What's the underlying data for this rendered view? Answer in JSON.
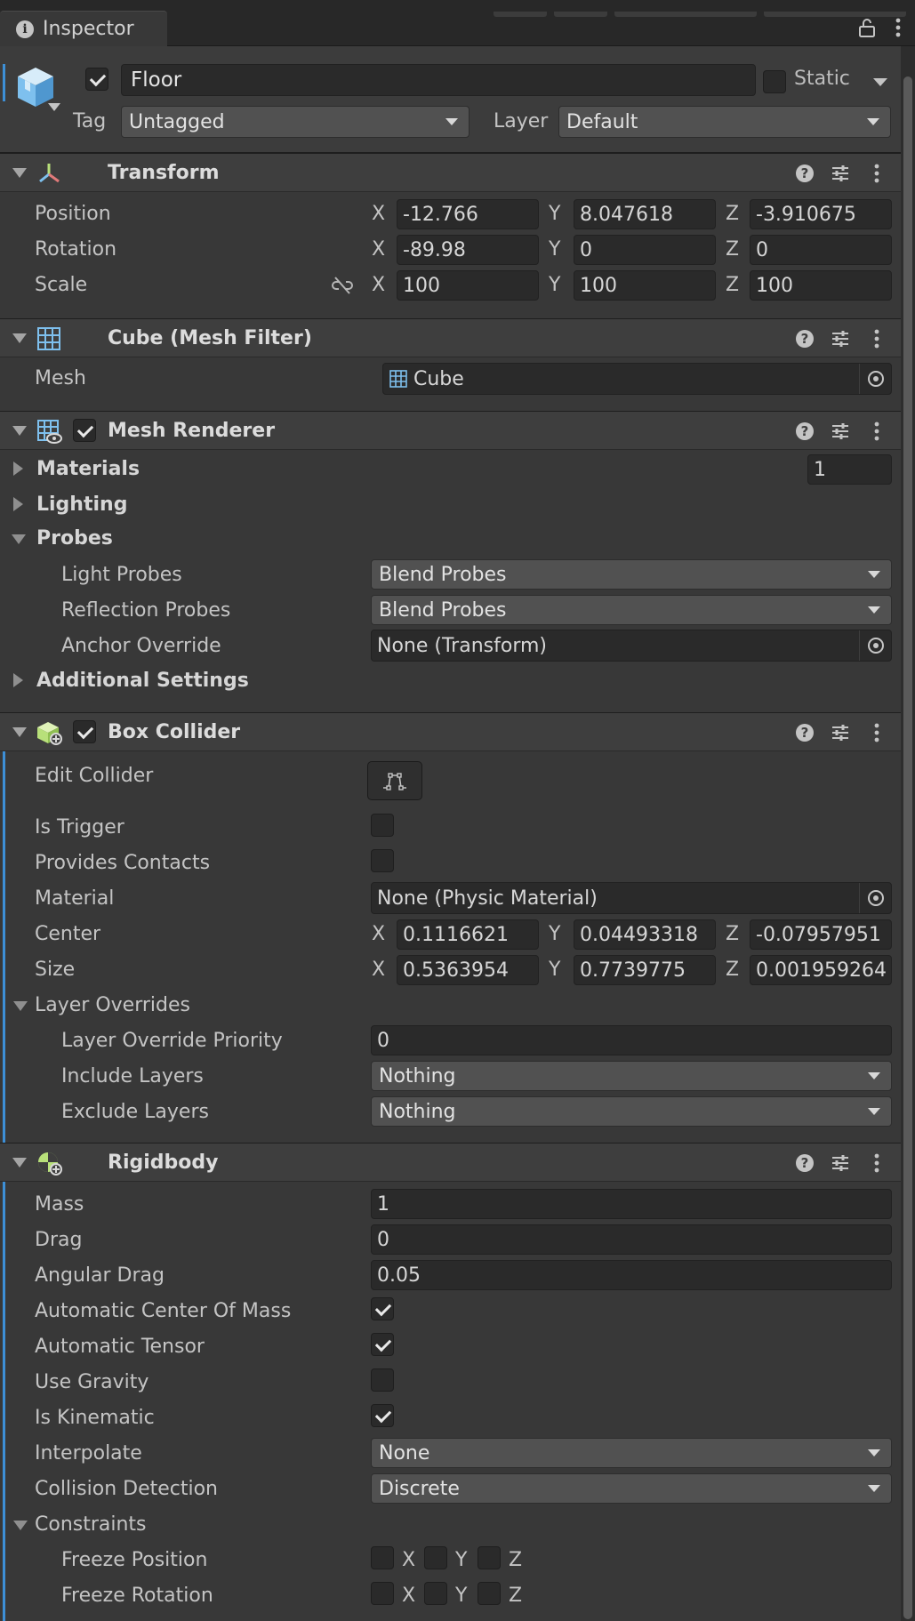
{
  "tab": {
    "title": "Inspector"
  },
  "gameobject": {
    "name": "Floor",
    "active": true,
    "static_label": "Static",
    "static": false,
    "tag_label": "Tag",
    "tag": "Untagged",
    "layer_label": "Layer",
    "layer": "Default"
  },
  "transform": {
    "title": "Transform",
    "position_label": "Position",
    "rotation_label": "Rotation",
    "scale_label": "Scale",
    "axis": {
      "x": "X",
      "y": "Y",
      "z": "Z"
    },
    "position": {
      "x": "-12.766",
      "y": "8.047618",
      "z": "-3.910675"
    },
    "rotation": {
      "x": "-89.98",
      "y": "0",
      "z": "0"
    },
    "scale": {
      "x": "100",
      "y": "100",
      "z": "100"
    }
  },
  "mesh_filter": {
    "title": "Cube (Mesh Filter)",
    "mesh_label": "Mesh",
    "mesh": "Cube"
  },
  "mesh_renderer": {
    "title": "Mesh Renderer",
    "enabled": true,
    "materials_label": "Materials",
    "materials_count": "1",
    "lighting_label": "Lighting",
    "probes_label": "Probes",
    "light_probes_label": "Light Probes",
    "light_probes": "Blend Probes",
    "reflection_probes_label": "Reflection Probes",
    "reflection_probes": "Blend Probes",
    "anchor_override_label": "Anchor Override",
    "anchor_override": "None (Transform)",
    "additional_settings_label": "Additional Settings"
  },
  "box_collider": {
    "title": "Box Collider",
    "enabled": true,
    "edit_collider_label": "Edit Collider",
    "is_trigger_label": "Is Trigger",
    "is_trigger": false,
    "provides_contacts_label": "Provides Contacts",
    "provides_contacts": false,
    "material_label": "Material",
    "material": "None (Physic Material)",
    "center_label": "Center",
    "center": {
      "x": "0.1116621",
      "y": "0.04493318",
      "z": "-0.07957951"
    },
    "size_label": "Size",
    "size": {
      "x": "0.5363954",
      "y": "0.7739775",
      "z": "0.001959264"
    },
    "layer_overrides_label": "Layer Overrides",
    "priority_label": "Layer Override Priority",
    "priority": "0",
    "include_layers_label": "Include Layers",
    "include_layers": "Nothing",
    "exclude_layers_label": "Exclude Layers",
    "exclude_layers": "Nothing"
  },
  "rigidbody": {
    "title": "Rigidbody",
    "mass_label": "Mass",
    "mass": "1",
    "drag_label": "Drag",
    "drag": "0",
    "angular_drag_label": "Angular Drag",
    "angular_drag": "0.05",
    "auto_com_label": "Automatic Center Of Mass",
    "auto_com": true,
    "auto_tensor_label": "Automatic Tensor",
    "auto_tensor": true,
    "use_gravity_label": "Use Gravity",
    "use_gravity": false,
    "is_kinematic_label": "Is Kinematic",
    "is_kinematic": true,
    "interpolate_label": "Interpolate",
    "interpolate": "None",
    "collision_detection_label": "Collision Detection",
    "collision_detection": "Discrete",
    "constraints_label": "Constraints",
    "freeze_position_label": "Freeze Position",
    "freeze_rotation_label": "Freeze Rotation"
  },
  "colors": {
    "background": "#383838",
    "header": "#3e3e3e",
    "field": "#2a2a2a",
    "dropdown": "#515151",
    "accent": "#3d8fd6",
    "icon_green": "#b8e07a",
    "icon_blue": "#7ec0ee"
  }
}
